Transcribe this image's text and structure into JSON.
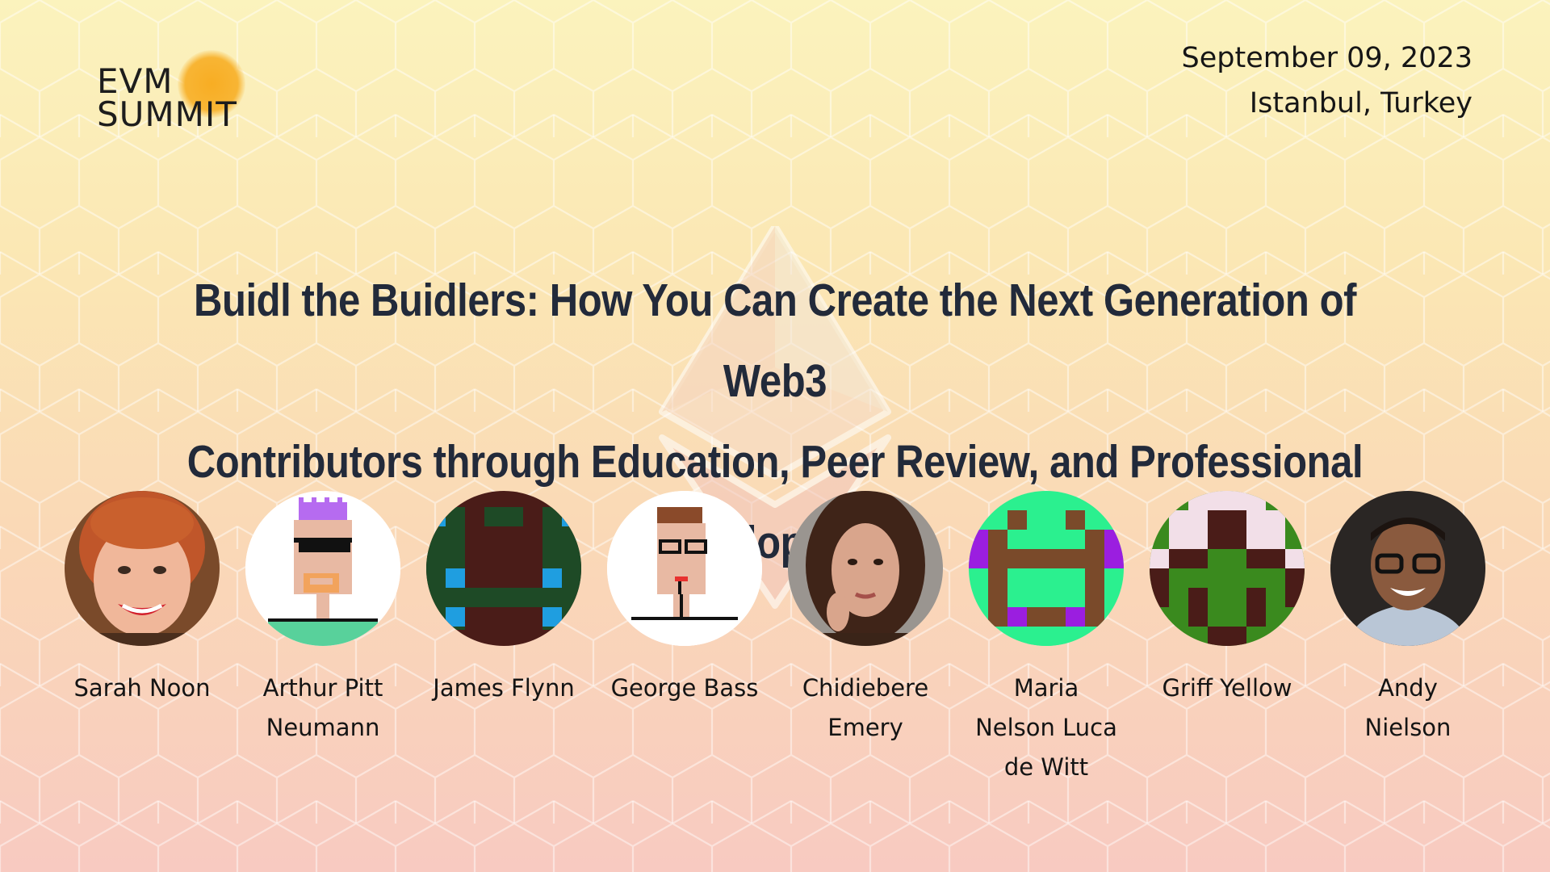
{
  "logo": {
    "line1": "EVM",
    "line2": "SUMMIT",
    "accent_color": "#f8b534"
  },
  "event": {
    "date": "September 09, 2023",
    "location": "Istanbul, Turkey"
  },
  "title": {
    "line1": "Buidl the Buidlers: How You Can Create the Next Generation of Web3",
    "line2": "Contributors through Education, Peer Review, and Professional Development",
    "color": "#222a3a"
  },
  "background_icon": "ethereum-logo",
  "speakers": [
    {
      "name_lines": [
        "Sarah Noon"
      ],
      "avatar": "photo-woman-red-hair"
    },
    {
      "name_lines": [
        "Arthur Pitt",
        "Neumann"
      ],
      "avatar": "pixel-punk-sunglasses"
    },
    {
      "name_lines": [
        "James Flynn"
      ],
      "avatar": "pixel-pattern-green-brown"
    },
    {
      "name_lines": [
        "George Bass"
      ],
      "avatar": "pixel-punk-glasses"
    },
    {
      "name_lines": [
        "Chidiebere",
        "Emery"
      ],
      "avatar": "photo-woman-brown-hair"
    },
    {
      "name_lines": [
        "Maria",
        "Nelson Luca",
        "de Witt"
      ],
      "avatar": "pixel-pattern-mint-purple"
    },
    {
      "name_lines": [
        "Griff Yellow"
      ],
      "avatar": "pixel-pattern-green-white"
    },
    {
      "name_lines": [
        "Andy",
        "Nielson"
      ],
      "avatar": "photo-man-glasses"
    }
  ]
}
